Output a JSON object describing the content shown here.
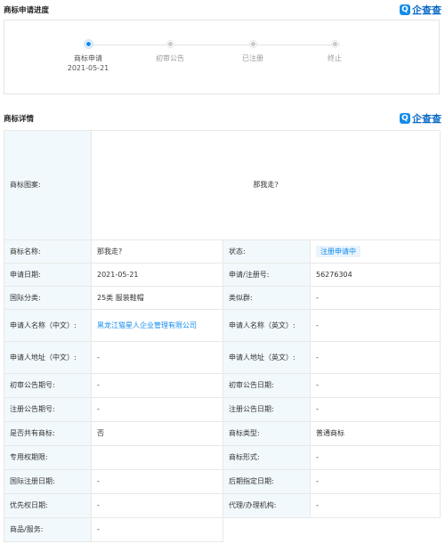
{
  "progress": {
    "title": "商标申请进度",
    "brand": "企查查",
    "brand_icon": "Q",
    "steps": [
      {
        "label": "商标申请",
        "date": "2021-05-21",
        "active": true
      },
      {
        "label": "初审公告",
        "date": "",
        "active": false
      },
      {
        "label": "已注册",
        "date": "",
        "active": false
      },
      {
        "label": "终止",
        "date": "",
        "active": false
      }
    ]
  },
  "detail": {
    "title": "商标详情",
    "brand": "企查查",
    "brand_icon": "Q",
    "image_label": "商标图案:",
    "image_text": "那我走?",
    "name_label": "商标名称:",
    "name_value": "那我走?",
    "status_label": "状态:",
    "status_value": "注册申请中",
    "rows": [
      {
        "k1": "申请日期:",
        "v1": "2021-05-21",
        "k2": "申请/注册号:",
        "v2": "56276304"
      },
      {
        "k1": "国际分类:",
        "v1": "25类 服装鞋帽",
        "k2": "类似群:",
        "v2": "-"
      },
      {
        "k1": "申请人名称（中文）:",
        "v1": "黑龙江猫星人企业管理有限公司",
        "k2": "申请人名称（英文）:",
        "v2": "-"
      },
      {
        "k1": "申请人地址（中文）:",
        "v1": "-",
        "k2": "申请人地址（英文）:",
        "v2": "-"
      },
      {
        "k1": "初审公告期号:",
        "v1": "-",
        "k2": "初审公告日期:",
        "v2": "-"
      },
      {
        "k1": "注册公告期号:",
        "v1": "-",
        "k2": "注册公告日期:",
        "v2": "-"
      },
      {
        "k1": "是否共有商标:",
        "v1": "否",
        "k2": "商标类型:",
        "v2": "普通商标"
      },
      {
        "k1": "专用权期限:",
        "v1": "",
        "k2": "商标形式:",
        "v2": "-"
      },
      {
        "k1": "国际注册日期:",
        "v1": "-",
        "k2": "后期指定日期:",
        "v2": "-"
      },
      {
        "k1": "优先权日期:",
        "v1": "-",
        "k2": "代理/办理机构:",
        "v2": "-"
      }
    ],
    "goods_label": "商品/服务:",
    "goods_value": "-"
  }
}
